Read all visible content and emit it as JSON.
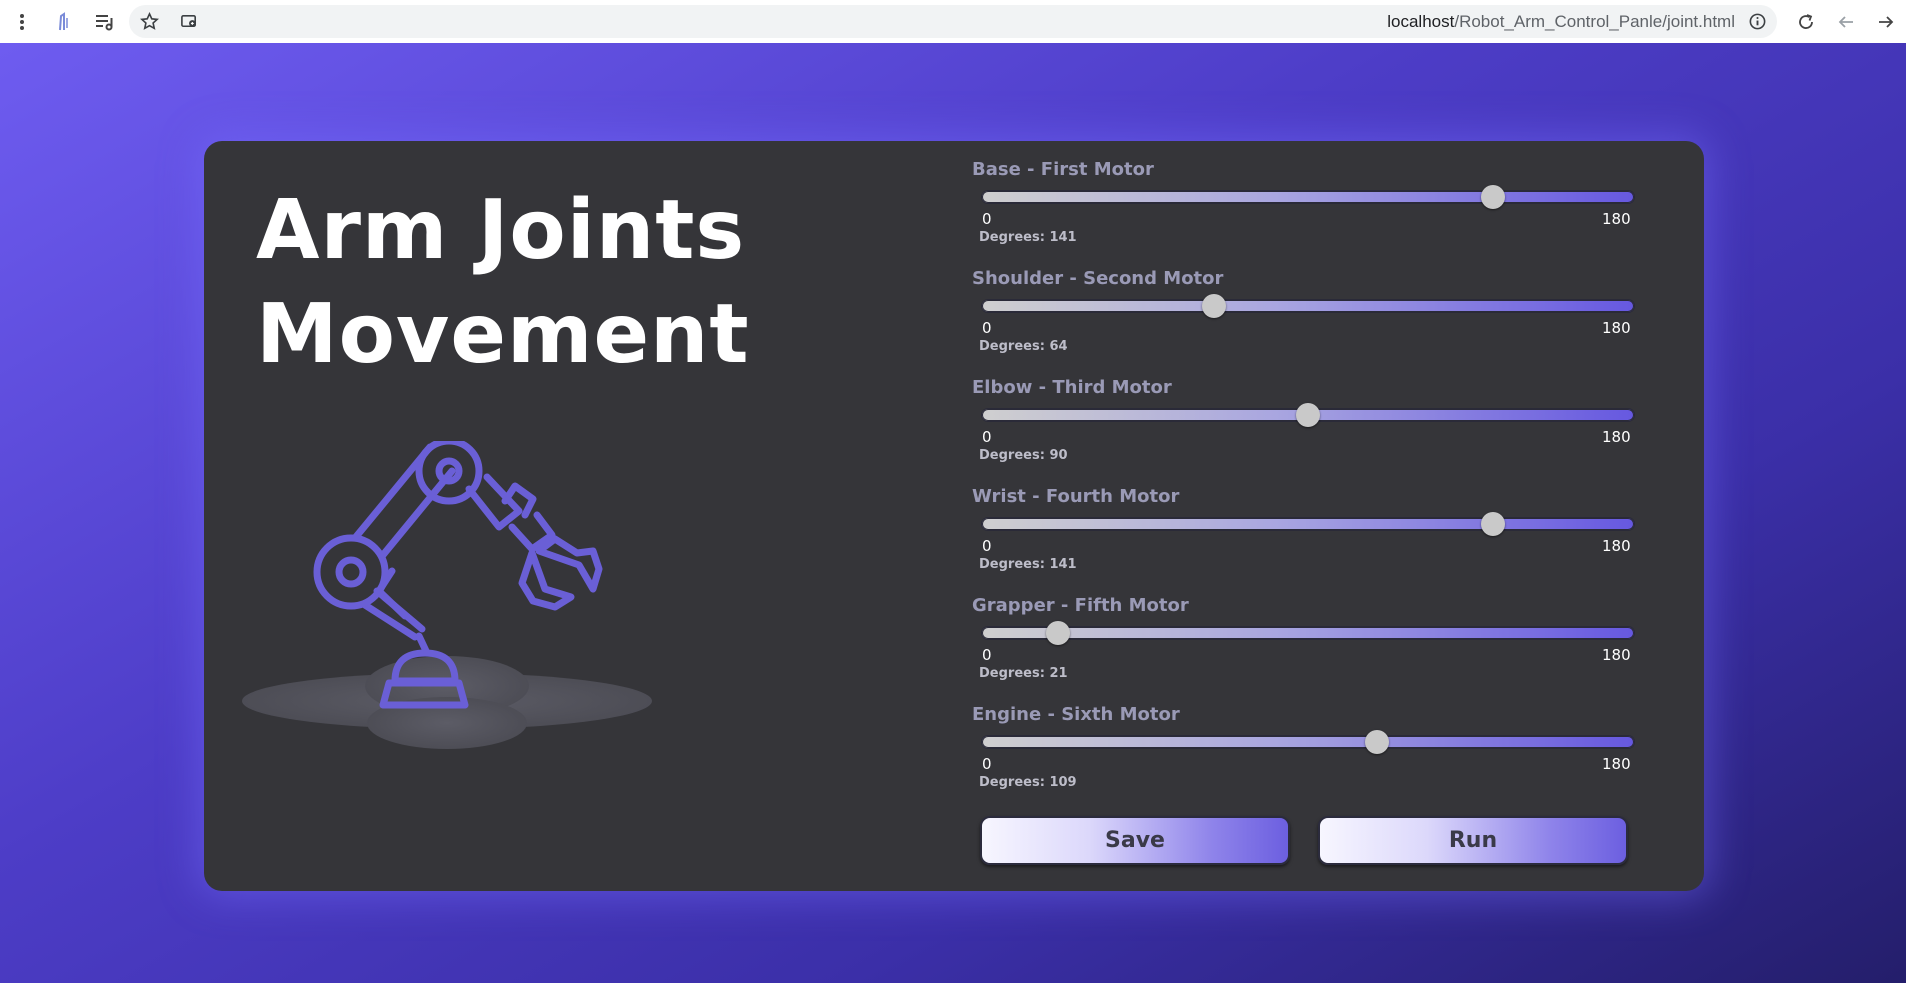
{
  "browser": {
    "url_host": "localhost",
    "url_path": "/Robot_Arm_Control_Panle/joint.html"
  },
  "page": {
    "title_line1": "Arm Joints",
    "title_line2": "Movement"
  },
  "sliders": [
    {
      "label": "Base - First Motor",
      "min": "0",
      "max": "180",
      "degrees_label": "Degrees:",
      "value": 141
    },
    {
      "label": "Shoulder - Second Motor",
      "min": "0",
      "max": "180",
      "degrees_label": "Degrees:",
      "value": 64
    },
    {
      "label": "Elbow - Third Motor",
      "min": "0",
      "max": "180",
      "degrees_label": "Degrees:",
      "value": 90
    },
    {
      "label": "Wrist - Fourth Motor",
      "min": "0",
      "max": "180",
      "degrees_label": "Degrees:",
      "value": 141
    },
    {
      "label": "Grapper - Fifth Motor",
      "min": "0",
      "max": "180",
      "degrees_label": "Degrees:",
      "value": 21
    },
    {
      "label": "Engine - Sixth Motor",
      "min": "0",
      "max": "180",
      "degrees_label": "Degrees:",
      "value": 109
    }
  ],
  "buttons": {
    "save_label": "Save",
    "run_label": "Run"
  },
  "colors": {
    "accent": "#6658e0",
    "card_bg": "#353539",
    "label": "#9a9ab6"
  }
}
